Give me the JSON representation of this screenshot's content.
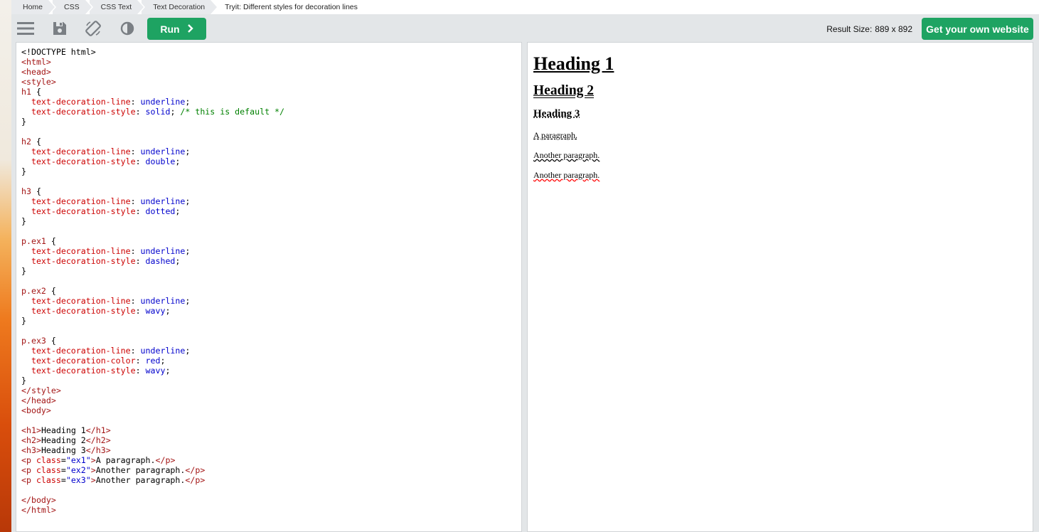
{
  "breadcrumb": {
    "items": [
      "Home",
      "CSS",
      "CSS Text",
      "Text Decoration"
    ],
    "current": "Tryit: Different styles for decoration lines"
  },
  "toolbar": {
    "menu_icon": "hamburger-menu-icon",
    "save_icon": "save-icon",
    "rotate_icon": "rotate-orientation-icon",
    "theme_icon": "contrast-theme-icon",
    "run_label": "Run",
    "run_icon": "chevron-right-icon",
    "result_size_label": "Result Size:",
    "result_size_value": "889 x 892",
    "own_website_label": "Get your own website"
  },
  "code": [
    "<!DOCTYPE html>",
    "<html>",
    "<head>",
    "<style>",
    "h1 {",
    "  text-decoration-line: underline;",
    "  text-decoration-style: solid; /* this is default */",
    "}",
    "",
    "h2 {",
    "  text-decoration-line: underline;",
    "  text-decoration-style: double;",
    "}",
    "",
    "h3 {",
    "  text-decoration-line: underline;",
    "  text-decoration-style: dotted;",
    "}",
    "",
    "p.ex1 {",
    "  text-decoration-line: underline;",
    "  text-decoration-style: dashed;",
    "}",
    "",
    "p.ex2 {",
    "  text-decoration-line: underline;",
    "  text-decoration-style: wavy;",
    "}",
    "",
    "p.ex3 {",
    "  text-decoration-line: underline;",
    "  text-decoration-color: red;",
    "  text-decoration-style: wavy;",
    "}",
    "</style>",
    "</head>",
    "<body>",
    "",
    "<h1>Heading 1</h1>",
    "<h2>Heading 2</h2>",
    "<h3>Heading 3</h3>",
    "<p class=\"ex1\">A paragraph.</p>",
    "<p class=\"ex2\">Another paragraph.</p>",
    "<p class=\"ex3\">Another paragraph.</p>",
    "",
    "</body>",
    "</html>"
  ],
  "result": {
    "h1": "Heading 1",
    "h2": "Heading 2",
    "h3": "Heading 3",
    "p1": "A paragraph.",
    "p2": "Another paragraph.",
    "p3": "Another paragraph."
  },
  "colors": {
    "accent_green": "#1ea362",
    "toolbar_bg": "#e3e6e8"
  }
}
